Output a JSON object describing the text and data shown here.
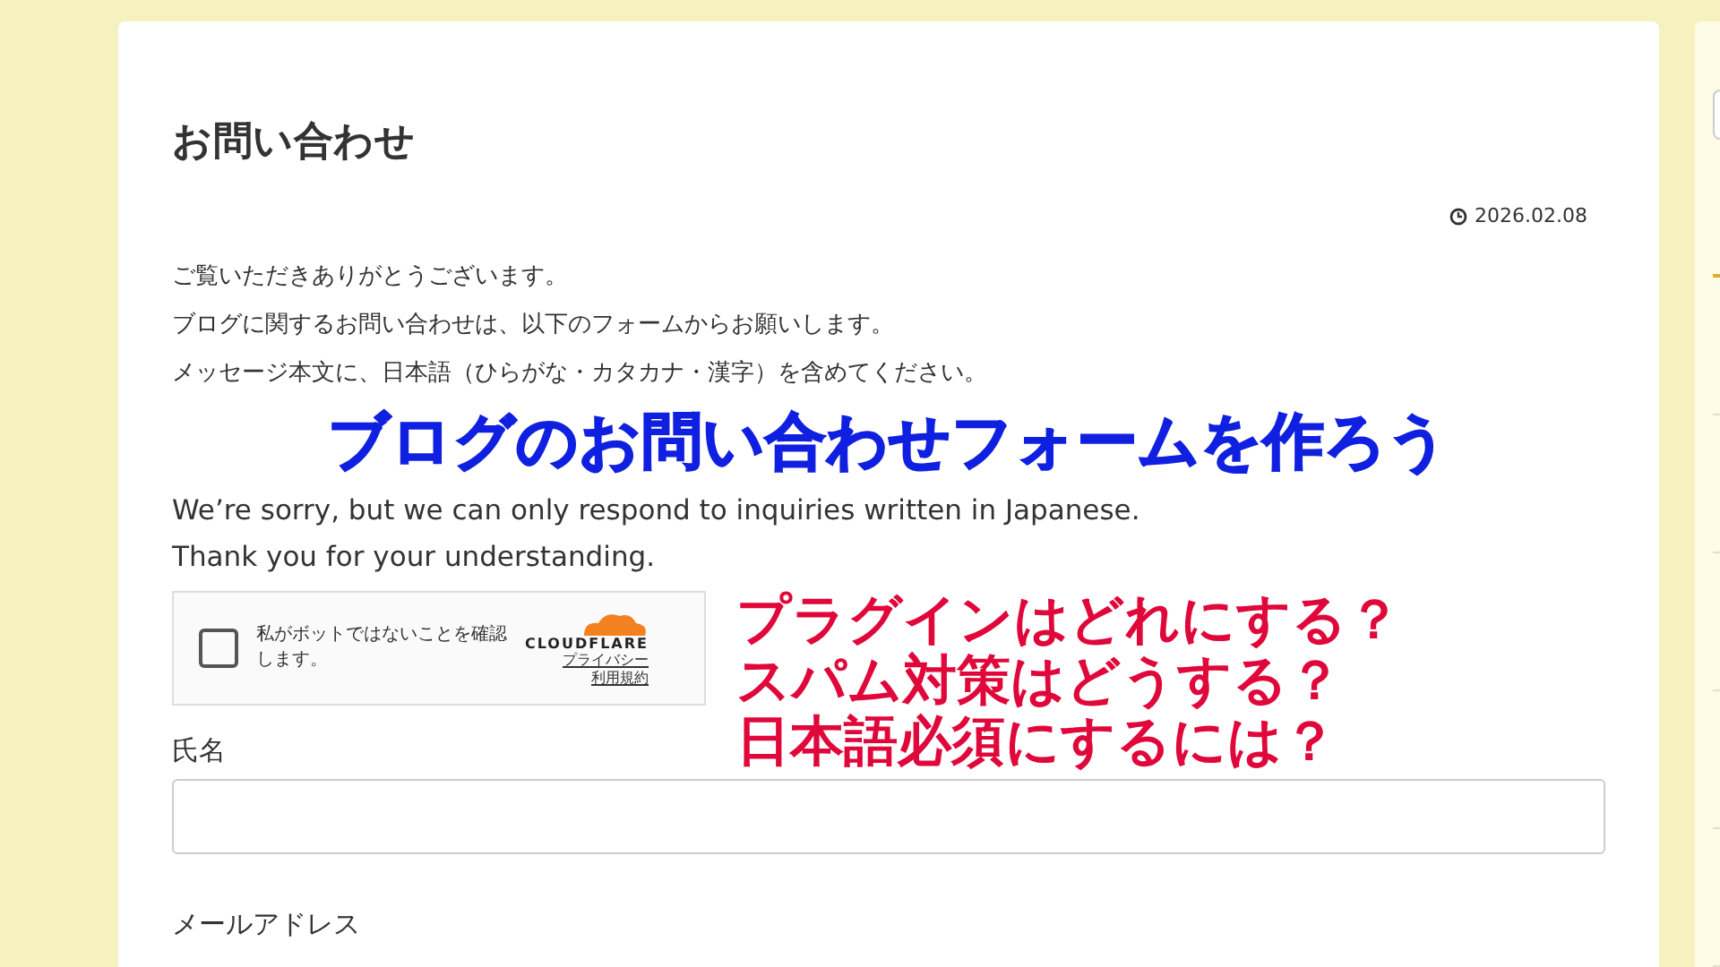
{
  "article": {
    "title": "お問い合わせ",
    "date": "2026.02.08",
    "paragraphs": [
      "ご覧いただきありがとうございます。",
      "ブログに関するお問い合わせは、以下のフォームからお願いします。",
      "メッセージ本文に、日本語（ひらがな・カタカナ・漢字）を含めてください。"
    ],
    "english": [
      "We’re sorry, but we can only respond to inquiries written in Japanese.",
      "Thank you for your understanding."
    ]
  },
  "captcha": {
    "checked": false,
    "label": "私がボットではないことを確認します。",
    "brand": "CLOUDFLARE",
    "links": [
      "プライバシー",
      "利用規約"
    ]
  },
  "fields": [
    {
      "label": "氏名"
    },
    {
      "label": "メールアドレス"
    }
  ],
  "overlay": {
    "headline": "ブログのお問い合わせフォームを作ろう",
    "questions": [
      "プラグインはどれにする？",
      "スパム対策はどうする？",
      "日本語必須にするには？"
    ]
  }
}
